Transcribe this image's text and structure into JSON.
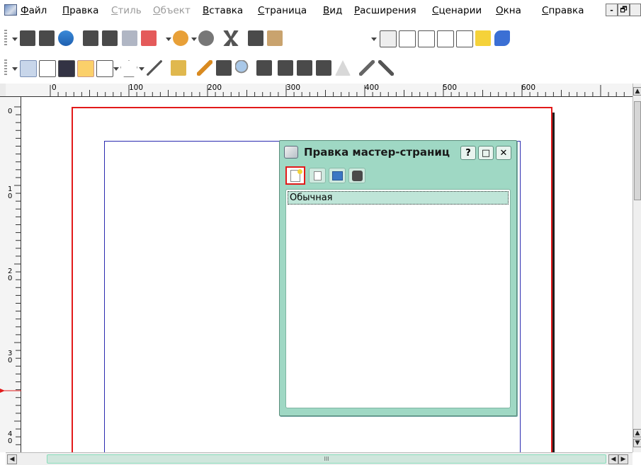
{
  "menubar": {
    "items": [
      {
        "label": "Файл",
        "enabled": true
      },
      {
        "label": "Правка",
        "enabled": true
      },
      {
        "label": "Стиль",
        "enabled": false
      },
      {
        "label": "Объект",
        "enabled": false
      },
      {
        "label": "Вставка",
        "enabled": true
      },
      {
        "label": "Страница",
        "enabled": true
      },
      {
        "label": "Вид",
        "enabled": true
      },
      {
        "label": "Расширения",
        "enabled": true
      },
      {
        "label": "Сценарии",
        "enabled": true
      },
      {
        "label": "Окна",
        "enabled": true
      },
      {
        "label": "Справка",
        "enabled": true
      }
    ],
    "window_controls": [
      "-",
      "🗗"
    ]
  },
  "ruler": {
    "h_labels": [
      "0",
      "100",
      "200",
      "300",
      "400",
      "500",
      "600"
    ],
    "v_labels": [
      "0",
      "1\n0",
      "2\n0",
      "3\n0",
      "4\n0"
    ]
  },
  "dialog": {
    "title": "Правка мастер-страниц",
    "help_label": "?",
    "maximize_label": "□",
    "close_label": "✕",
    "list_items": [
      "Обычная"
    ]
  },
  "scroll": {
    "h_grip": "III"
  },
  "colors": {
    "page_border": "#e21a1a",
    "margin_border": "#2a2ab0",
    "dialog_bg": "#9fd8c4",
    "selected_row": "#bfe5d8"
  }
}
